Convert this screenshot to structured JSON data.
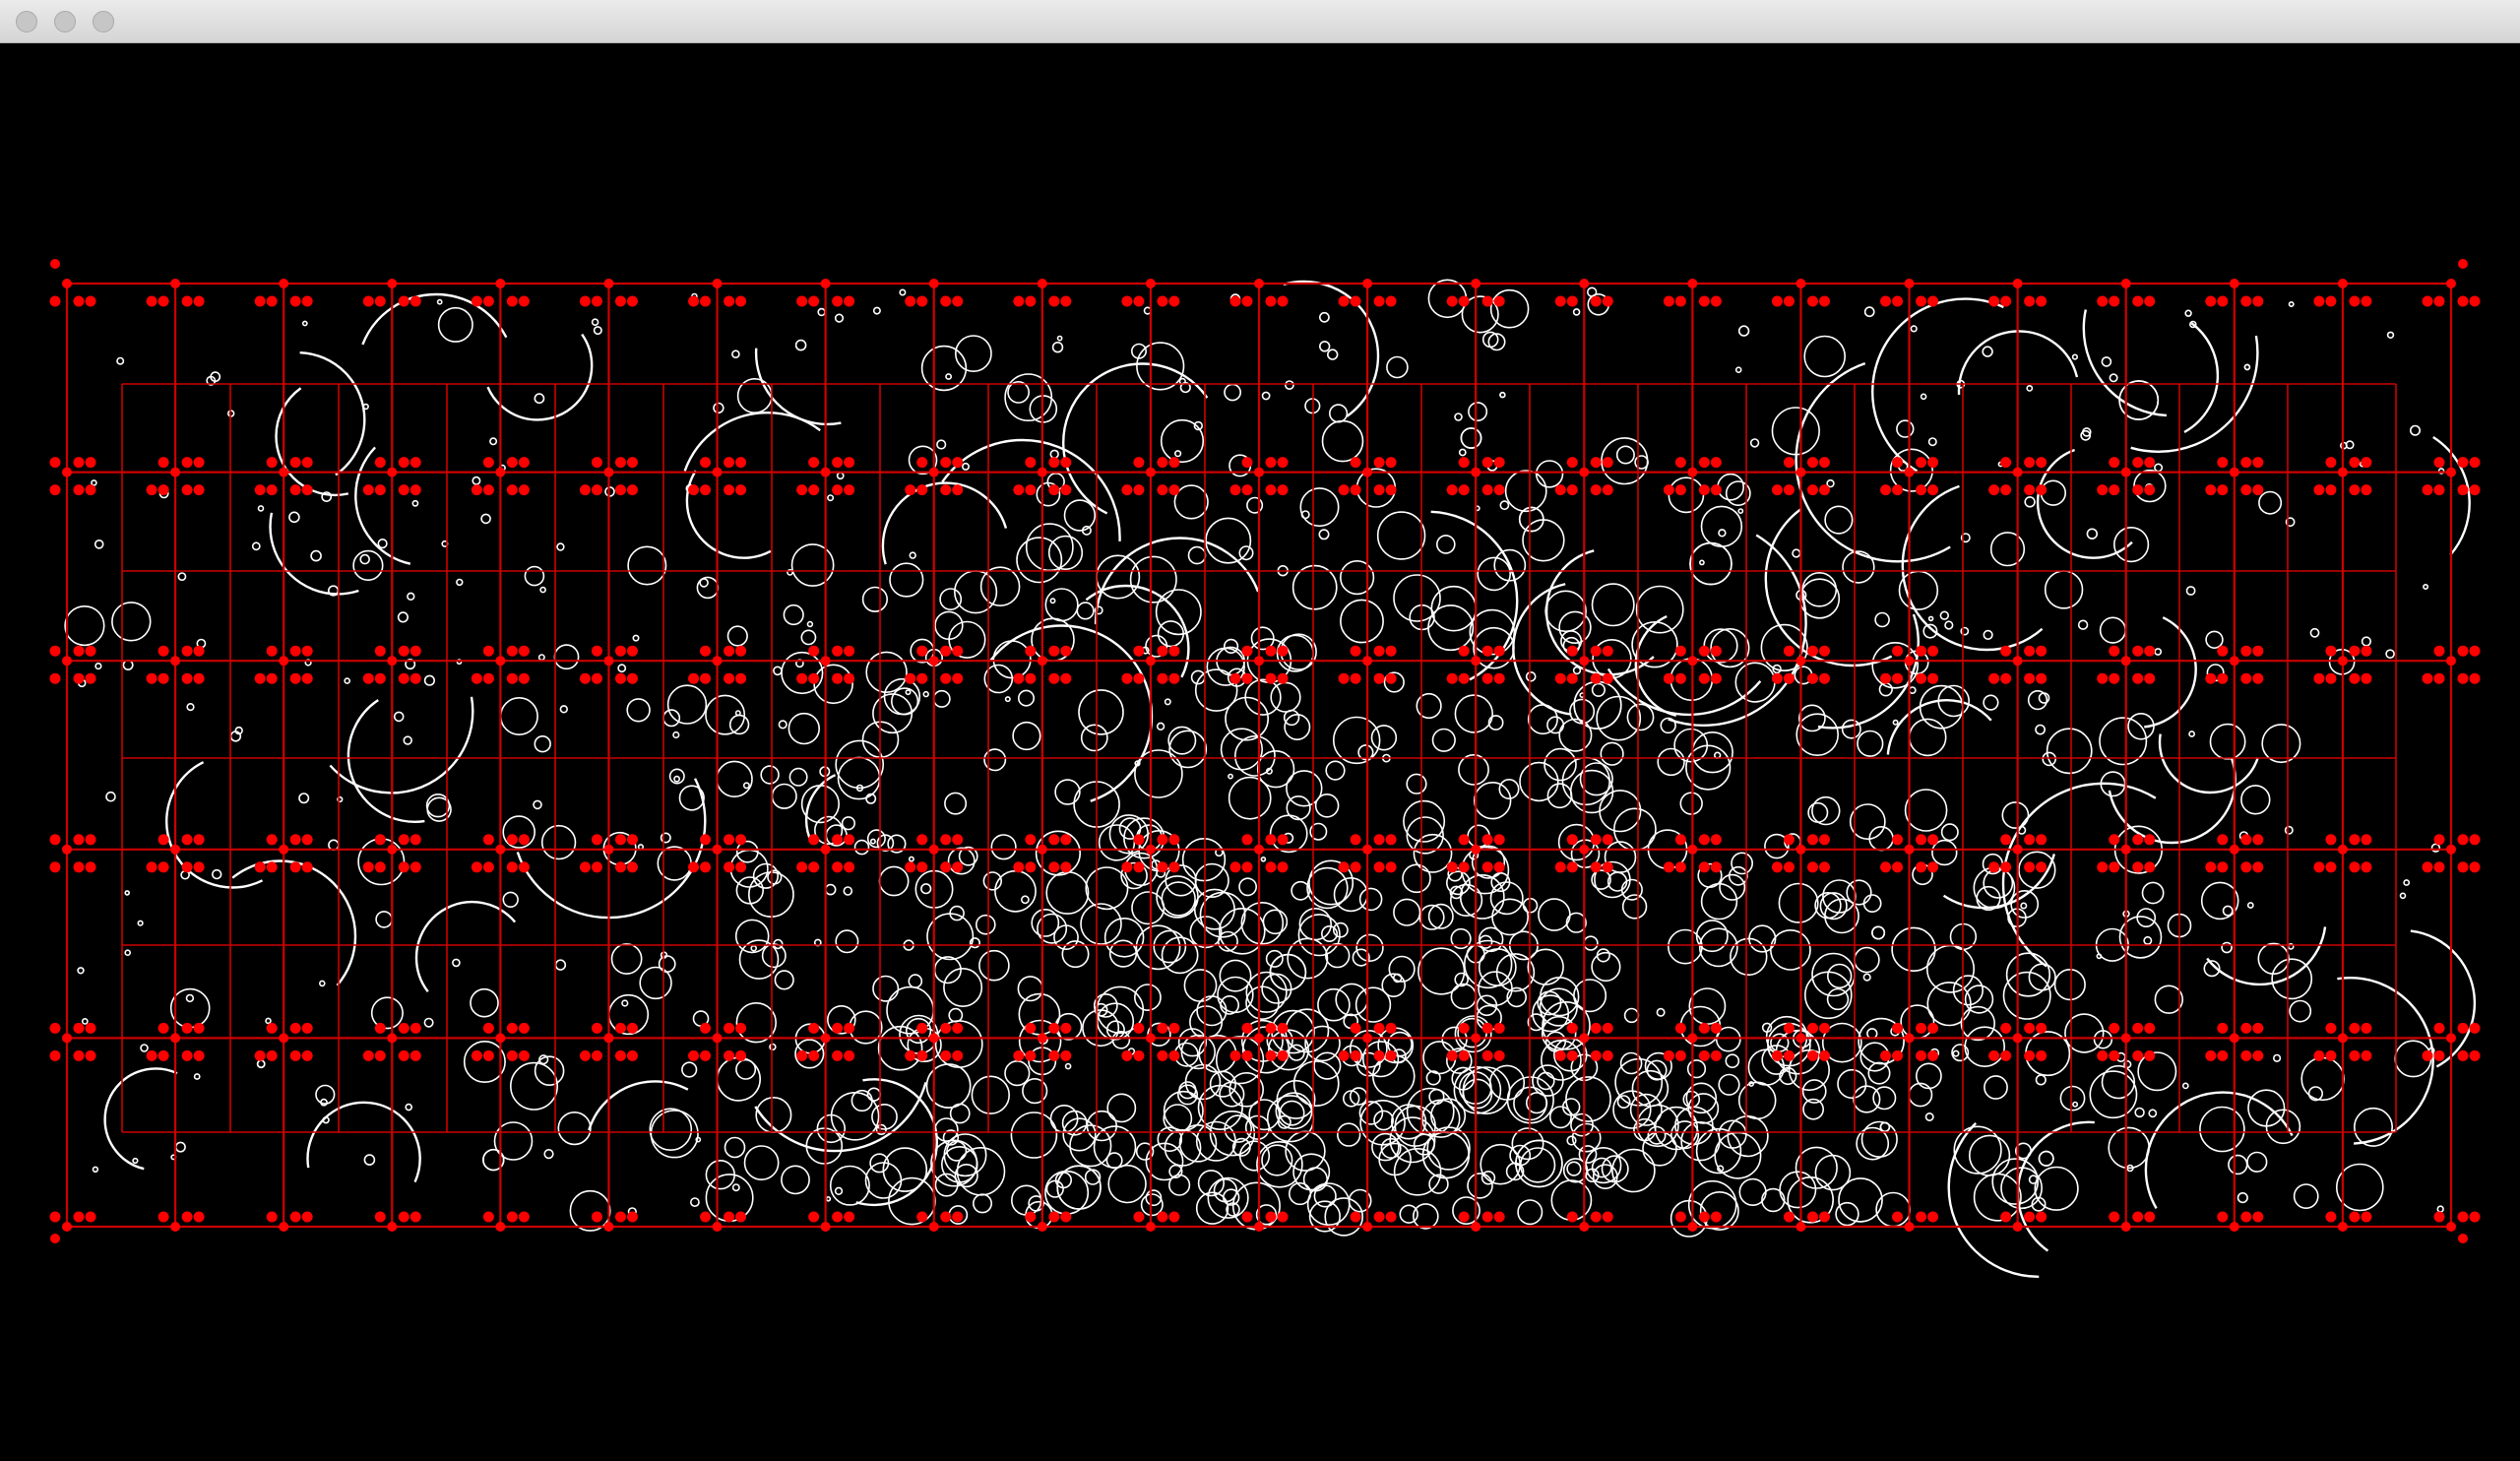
{
  "window": {
    "title": "",
    "buttons": [
      "close-button",
      "minimize-button",
      "maximize-button"
    ]
  },
  "canvas": {
    "background_color": "#000000",
    "grid_color": "#cc0000",
    "node_color": "#ff0000",
    "circle_color": "#ffffff",
    "grid": {
      "outer_columns": 22,
      "outer_rows": 5,
      "inner_columns": 21,
      "inner_rows": 4
    },
    "density_peak": "bottom-center"
  }
}
